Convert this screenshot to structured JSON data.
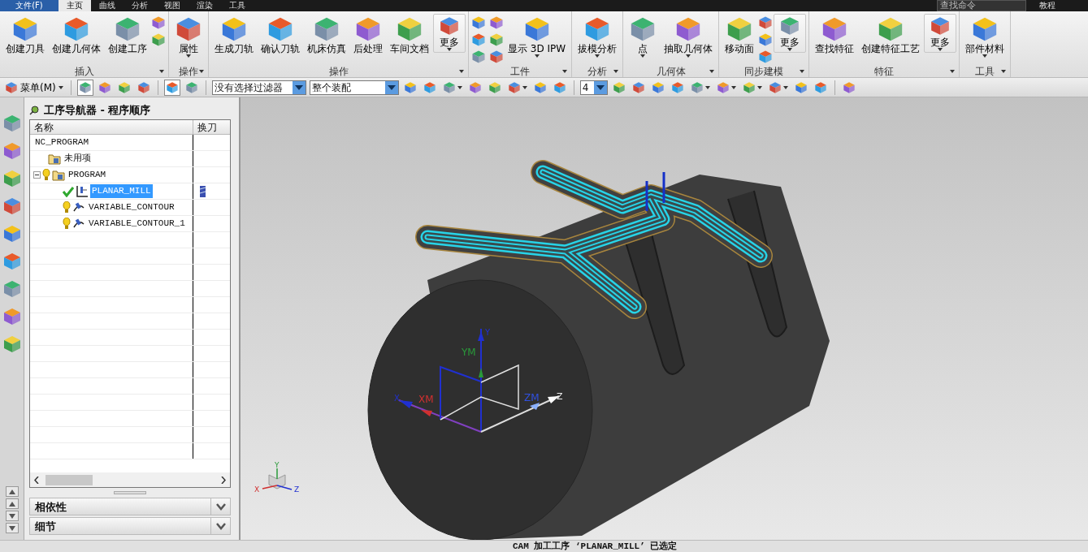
{
  "menu_tabs": [
    {
      "label": "文件(F)",
      "kind": "file",
      "selected": false
    },
    {
      "label": "主页",
      "kind": "tab",
      "selected": true
    },
    {
      "label": "曲线",
      "kind": "tab",
      "selected": false
    },
    {
      "label": "分析",
      "kind": "tab",
      "selected": false
    },
    {
      "label": "视图",
      "kind": "tab",
      "selected": false
    },
    {
      "label": "渲染",
      "kind": "tab",
      "selected": false
    },
    {
      "label": "工具",
      "kind": "tab",
      "selected": false
    }
  ],
  "command_search": {
    "placeholder": "查找命令"
  },
  "help_link": "教程",
  "ribbon_groups": [
    {
      "label": "插入",
      "items": [
        {
          "kind": "large",
          "label": "创建刀具",
          "dropdown": false
        },
        {
          "kind": "large",
          "label": "创建几何体",
          "dropdown": false
        },
        {
          "kind": "large",
          "label": "创建工序",
          "dropdown": false
        },
        {
          "kind": "small"
        },
        {
          "kind": "small"
        }
      ]
    },
    {
      "label": "操作",
      "items": [
        {
          "kind": "large",
          "label": "属性",
          "dropdown": true
        }
      ]
    },
    {
      "label": "操作",
      "items": [
        {
          "kind": "large",
          "label": "生成刀轨",
          "dropdown": false
        },
        {
          "kind": "large",
          "label": "确认刀轨",
          "dropdown": false
        },
        {
          "kind": "large",
          "label": "机床仿真",
          "dropdown": false
        },
        {
          "kind": "large",
          "label": "后处理",
          "dropdown": false
        },
        {
          "kind": "large",
          "label": "车间文档",
          "dropdown": false
        },
        {
          "kind": "boxed",
          "label": "更多",
          "dropdown": true
        }
      ]
    },
    {
      "label": "工件",
      "items": [
        {
          "kind": "small"
        },
        {
          "kind": "small"
        },
        {
          "kind": "small"
        },
        {
          "kind": "small"
        },
        {
          "kind": "small"
        },
        {
          "kind": "small"
        },
        {
          "kind": "large",
          "label": "显示 3D IPW",
          "dropdown": true
        }
      ]
    },
    {
      "label": "分析",
      "items": [
        {
          "kind": "large",
          "label": "拔模分析",
          "dropdown": true
        }
      ]
    },
    {
      "label": "几何体",
      "items": [
        {
          "kind": "large",
          "label": "点",
          "dropdown": true
        },
        {
          "kind": "large",
          "label": "抽取几何体",
          "dropdown": true
        }
      ]
    },
    {
      "label": "同步建模",
      "items": [
        {
          "kind": "large",
          "label": "移动面",
          "dropdown": false
        },
        {
          "kind": "small"
        },
        {
          "kind": "small"
        },
        {
          "kind": "small"
        },
        {
          "kind": "boxed",
          "label": "更多",
          "dropdown": true
        }
      ]
    },
    {
      "label": "特征",
      "items": [
        {
          "kind": "large",
          "label": "查找特征",
          "dropdown": false
        },
        {
          "kind": "large",
          "label": "创建特征工艺",
          "dropdown": false
        },
        {
          "kind": "boxed",
          "label": "更多",
          "dropdown": true
        }
      ]
    },
    {
      "label": "工具",
      "items": [
        {
          "kind": "large",
          "label": "部件材料",
          "dropdown": true
        }
      ]
    }
  ],
  "toolbar": [
    {
      "kind": "menu",
      "label": "菜单(M)",
      "dropdown": true
    },
    {
      "kind": "separator"
    },
    {
      "kind": "icon",
      "pressed": true,
      "dropdown": false
    },
    {
      "kind": "icon",
      "pressed": false,
      "dropdown": false
    },
    {
      "kind": "icon",
      "pressed": false,
      "dropdown": false
    },
    {
      "kind": "icon",
      "pressed": false,
      "dropdown": false
    },
    {
      "kind": "separator"
    },
    {
      "kind": "icon",
      "pressed": true,
      "dropdown": false
    },
    {
      "kind": "icon",
      "pressed": false,
      "dropdown": false
    },
    {
      "kind": "separator"
    },
    {
      "kind": "select",
      "value": "没有选择过滤器"
    },
    {
      "kind": "select",
      "value": "整个装配"
    },
    {
      "kind": "icon",
      "pressed": false,
      "dropdown": false
    },
    {
      "kind": "icon",
      "pressed": false,
      "dropdown": false
    },
    {
      "kind": "icon",
      "pressed": false,
      "dropdown": true
    },
    {
      "kind": "icon",
      "pressed": false,
      "dropdown": false
    },
    {
      "kind": "icon",
      "pressed": false,
      "dropdown": false
    },
    {
      "kind": "icon",
      "pressed": false,
      "dropdown": true
    },
    {
      "kind": "icon",
      "pressed": false,
      "dropdown": false
    },
    {
      "kind": "icon",
      "pressed": false,
      "dropdown": false
    },
    {
      "kind": "separator"
    },
    {
      "kind": "select",
      "value": "4"
    },
    {
      "kind": "icon",
      "pressed": false,
      "dropdown": false
    },
    {
      "kind": "icon",
      "pressed": false,
      "dropdown": false
    },
    {
      "kind": "icon",
      "pressed": false,
      "dropdown": false
    },
    {
      "kind": "icon",
      "pressed": false,
      "dropdown": false
    },
    {
      "kind": "icon",
      "pressed": false,
      "dropdown": true
    },
    {
      "kind": "icon",
      "pressed": false,
      "dropdown": true
    },
    {
      "kind": "icon",
      "pressed": false,
      "dropdown": true
    },
    {
      "kind": "icon",
      "pressed": false,
      "dropdown": true
    },
    {
      "kind": "icon",
      "pressed": false,
      "dropdown": false
    },
    {
      "kind": "icon",
      "pressed": false,
      "dropdown": false
    },
    {
      "kind": "separator"
    },
    {
      "kind": "icon",
      "pressed": false,
      "dropdown": false
    }
  ],
  "navigator": {
    "title": "工序导航器 - 程序顺序",
    "columns": [
      "名称",
      "换刀"
    ],
    "tree": [
      {
        "name": "NC_PROGRAM",
        "kind": "root",
        "selected": false,
        "children": [
          {
            "name": "未用项",
            "kind": "group",
            "selected": false
          },
          {
            "name": "PROGRAM",
            "kind": "group",
            "complete": false,
            "expanded": true,
            "selected": false,
            "children": [
              {
                "name": "PLANAR_MILL",
                "kind": "planar",
                "complete": true,
                "tool_change": true,
                "selected": true
              },
              {
                "name": "VARIABLE_CONTOUR",
                "kind": "contour",
                "complete": false,
                "tool_change": false,
                "selected": false
              },
              {
                "name": "VARIABLE_CONTOUR_1",
                "kind": "contour",
                "complete": false,
                "tool_change": false,
                "selected": false
              }
            ]
          }
        ]
      }
    ],
    "sections": [
      {
        "label": "相依性",
        "expanded": false
      },
      {
        "label": "细节",
        "expanded": false
      }
    ]
  },
  "viewport": {
    "csys": {
      "x": "X",
      "y": "Y",
      "z": "Z",
      "xm": "XM",
      "ym": "YM",
      "zm": "ZM"
    },
    "view_triad": {
      "x": "X",
      "y": "Y",
      "z": "Z"
    }
  },
  "status_bar": {
    "message": "CAM 加工工序 ‘PLANAR_MILL’ 已选定"
  }
}
